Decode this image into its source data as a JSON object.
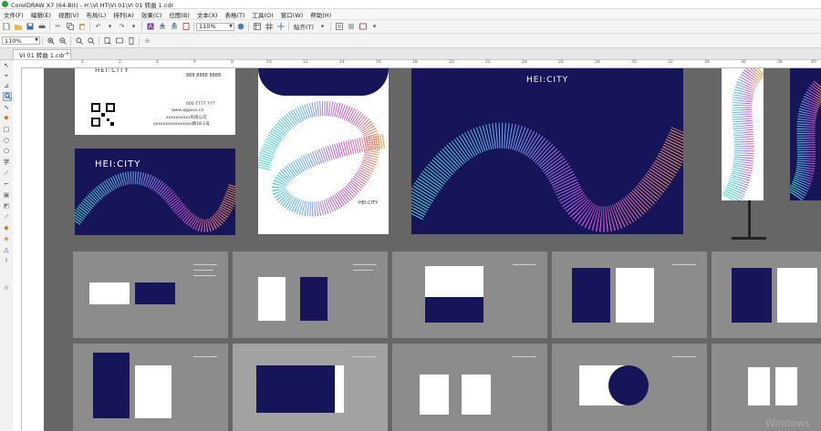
{
  "title_bar": {
    "text": "CorelDRAW X7 (64-Bit) - H:\\VI HT\\VI 01\\VI 01 转曲 1.cdr"
  },
  "menu": [
    "文件(F)",
    "编辑(E)",
    "视图(V)",
    "布局(L)",
    "排列(A)",
    "效果(C)",
    "位图(B)",
    "文本(X)",
    "表格(T)",
    "工具(O)",
    "窗口(W)",
    "帮助(H)"
  ],
  "toolbar": {
    "zoom_value": "110%",
    "snap_label": "贴齐(T)"
  },
  "property_bar": {
    "zoom_value": "110%"
  },
  "document_tab": {
    "label": "VI 01 转曲 1.cdr",
    "add": "+"
  },
  "ruler": {
    "ticks": [
      "0",
      "2",
      "4",
      "6",
      "8",
      "10",
      "12",
      "14",
      "16",
      "18",
      "20",
      "22",
      "24",
      "26",
      "28",
      "30",
      "32",
      "34",
      "36",
      "38",
      "40",
      "42"
    ]
  },
  "card": {
    "phone": "888 8888 8888",
    "phone2": "000 7777 777",
    "web": "www.qqqxxx.cn",
    "company": "xxxxxxxxxx有限公司",
    "address": "xxxxxxxxxxxxxxxx路18-1号"
  },
  "brand": {
    "logo": "HEI:CITY"
  },
  "watermark": "Windows",
  "colors": {
    "navy": "#17155a",
    "canvas_gray": "#666666",
    "page_bg": "#ffffff",
    "thumb_bg": "#8c8c8c"
  },
  "icons": [
    "pointer-icon",
    "shape-icon",
    "crop-icon",
    "zoom-icon",
    "freehand-icon",
    "smart-fill-icon",
    "rectangle-icon",
    "ellipse-icon",
    "polygon-icon",
    "text-icon",
    "parallel-dimension-icon",
    "connector-icon",
    "drop-shadow-icon",
    "transparency-icon",
    "eyedropper-icon",
    "interactive-fill-icon",
    "smart-fill-2-icon",
    "outline-icon",
    "add-icon"
  ]
}
